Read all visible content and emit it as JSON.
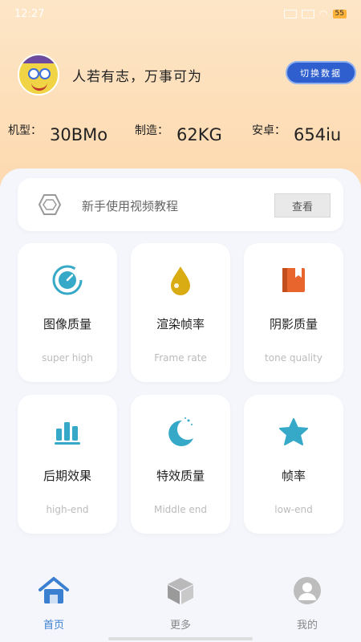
{
  "status_bar": {
    "time": "12:27",
    "signal": "4G",
    "battery": "55"
  },
  "profile": {
    "motto": "人若有志，万事可为",
    "switch_button": "切换数据"
  },
  "stats": [
    {
      "label": "机型：",
      "value": "30BMo"
    },
    {
      "label": "制造：",
      "value": "62KG"
    },
    {
      "label": "安卓：",
      "value": "654iu"
    }
  ],
  "tutorial": {
    "text": "新手使用视频教程",
    "button": "查看"
  },
  "cards": [
    {
      "title": "图像质量",
      "subtitle": "super high",
      "icon": "gauge-icon"
    },
    {
      "title": "渲染帧率",
      "subtitle": "Frame rate",
      "icon": "drop-icon"
    },
    {
      "title": "阴影质量",
      "subtitle": "tone quality",
      "icon": "book-icon"
    },
    {
      "title": "后期效果",
      "subtitle": "high-end",
      "icon": "bars-icon"
    },
    {
      "title": "特效质量",
      "subtitle": "Middle end",
      "icon": "moon-icon"
    },
    {
      "title": "帧率",
      "subtitle": "low-end",
      "icon": "star-icon"
    }
  ],
  "nav": [
    {
      "label": "首页",
      "icon": "home-icon",
      "active": true
    },
    {
      "label": "更多",
      "icon": "cube-icon",
      "active": false
    },
    {
      "label": "我的",
      "icon": "user-icon",
      "active": false
    }
  ],
  "colors": {
    "accent": "#3b7fd0",
    "icon_teal": "#36a9c9",
    "icon_gold": "#d9ac14",
    "icon_orange": "#e8662e",
    "header_bg": "#fde0bb"
  }
}
